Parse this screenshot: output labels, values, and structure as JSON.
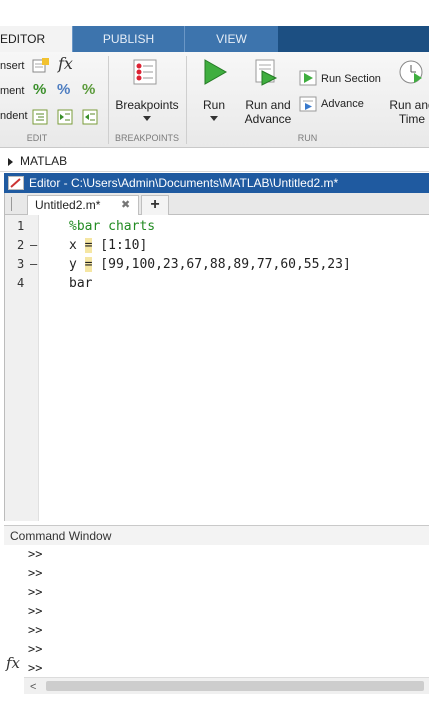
{
  "tabs": [
    {
      "label": "EDITOR"
    },
    {
      "label": "PUBLISH"
    },
    {
      "label": "VIEW"
    }
  ],
  "edit_group": {
    "insert_label": "nsert",
    "comment_label": "ment",
    "indent_label": "ndent",
    "label": "EDIT"
  },
  "breakpoints_group": {
    "button_label": "Breakpoints",
    "label": "BREAKPOINTS"
  },
  "run_group": {
    "run_label": "Run",
    "run_advance_label_1": "Run and",
    "run_advance_label_2": "Advance",
    "run_section_label": "Run Section",
    "advance_label": "Advance",
    "run_time_label_1": "Run and",
    "run_time_label_2": "Time",
    "label": "RUN"
  },
  "path": {
    "label": "MATLAB"
  },
  "editor": {
    "title": "Editor - C:\\Users\\Admin\\Documents\\MATLAB\\Untitled2.m*",
    "doc_tab": "Untitled2.m*",
    "close_glyph": "✖",
    "add_glyph": "+",
    "lines": [
      {
        "num": "1",
        "dash": "",
        "text": "%bar charts"
      },
      {
        "num": "2",
        "dash": "—",
        "pre": "x ",
        "eq": "=",
        "post": " [1:10]"
      },
      {
        "num": "3",
        "dash": "—",
        "pre": "y ",
        "eq": "=",
        "post": " [99,100,23,67,88,89,77,60,55,23]"
      },
      {
        "num": "4",
        "dash": "",
        "text": "bar"
      }
    ]
  },
  "command_window": {
    "title": "Command Window",
    "prompts": [
      ">>",
      ">>",
      ">>",
      ">>",
      ">>",
      ">>",
      ">>"
    ],
    "fx": "fx"
  },
  "colors": {
    "tab_bar": "#1c4f82",
    "editor_title": "#1f5aa0",
    "comment": "#228b22",
    "highlight": "#f5e6a3"
  }
}
